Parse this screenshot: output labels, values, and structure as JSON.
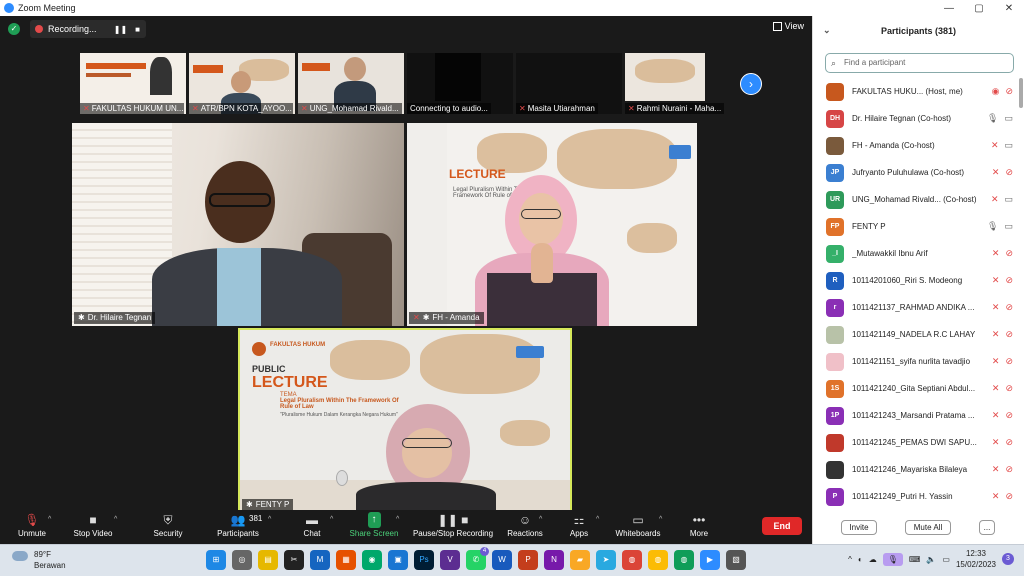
{
  "window": {
    "title": "Zoom Meeting",
    "controls": [
      "—",
      "▢",
      "✕"
    ]
  },
  "topbar": {
    "recording_label": "Recording...",
    "view_label": "View"
  },
  "thumbnails": [
    {
      "name": "FAKULTAS HUKUM UN...",
      "muted": true
    },
    {
      "name": "ATR/BPN KOTA_AYOO...",
      "muted": true
    },
    {
      "name": "UNG_Mohamad Rivald...",
      "muted": true
    },
    {
      "name": "Connecting to audio...",
      "muted": false
    },
    {
      "name": "Masita Utiarahman",
      "muted": true
    },
    {
      "name": "Rahmi Nuraini - Maha...",
      "muted": true
    }
  ],
  "tiles": {
    "a": {
      "name": "Dr. Hilaire Tegnan"
    },
    "b": {
      "name": "FH - Amanda"
    },
    "c": {
      "name": "FENTY P"
    }
  },
  "slide": {
    "kicker": "FAKULTAS HUKUM",
    "public": "PUBLIC",
    "lecture": "LECTURE",
    "tema": "TEMA",
    "theme": "Legal Pluralism Within The Framework Of Rule of Law",
    "subtheme": "\"Pluralisme Hukum Dalam Kerangka Negara Hukum\""
  },
  "toolbar": {
    "unmute": "Unmute",
    "stop_video": "Stop Video",
    "security": "Security",
    "participants": "Participants",
    "participants_count": "381",
    "chat": "Chat",
    "share_screen": "Share Screen",
    "pause_recording": "Pause/Stop Recording",
    "reactions": "Reactions",
    "apps": "Apps",
    "whiteboards": "Whiteboards",
    "more": "More",
    "end": "End"
  },
  "panel": {
    "title": "Participants (381)",
    "search_placeholder": "Find a participant",
    "invite": "Invite",
    "mute_all": "Mute All",
    "more": "...",
    "participants": [
      {
        "initials": "",
        "color": "#c7581e",
        "name": "FAKULTAS HUKU... (Host, me)",
        "mic": "rec",
        "video": "off"
      },
      {
        "initials": "DH",
        "color": "#d64545",
        "name": "Dr. Hilaire Tegnan (Co-host)",
        "mic": "on",
        "video": "on"
      },
      {
        "initials": "",
        "color": "#7a5a3c",
        "name": "FH - Amanda (Co-host)",
        "mic": "off",
        "video": "on"
      },
      {
        "initials": "JP",
        "color": "#3b7fd1",
        "name": "Jufryanto Puluhulawa (Co-host)",
        "mic": "off",
        "video": "off"
      },
      {
        "initials": "UR",
        "color": "#2e9a5a",
        "name": "UNG_Mohamad Rivald... (Co-host)",
        "mic": "off",
        "video": "on"
      },
      {
        "initials": "FP",
        "color": "#e0722a",
        "name": "FENTY P",
        "mic": "on",
        "video": "on"
      },
      {
        "initials": "_I",
        "color": "#35b06a",
        "name": "_Mutawakkil Ibnu Arif",
        "mic": "off",
        "video": "off"
      },
      {
        "initials": "R",
        "color": "#1f5fbf",
        "name": "10114201060_Riri S. Modeong",
        "mic": "off",
        "video": "off"
      },
      {
        "initials": "r",
        "color": "#8a2fb5",
        "name": "1011421137_RAHMAD ANDIKA ...",
        "mic": "off",
        "video": "off"
      },
      {
        "initials": "",
        "color": "#b8c2a8",
        "name": "1011421149_NADELA R.C LAHAY",
        "mic": "off",
        "video": "off"
      },
      {
        "initials": "",
        "color": "#f0c0c8",
        "name": "1011421151_syifa nurlita tavadjio",
        "mic": "off",
        "video": "off"
      },
      {
        "initials": "1S",
        "color": "#e0722a",
        "name": "1011421240_Gita Septiani Abdul...",
        "mic": "off",
        "video": "off"
      },
      {
        "initials": "1P",
        "color": "#8a2fb5",
        "name": "1011421243_Marsandi Pratama ...",
        "mic": "off",
        "video": "off"
      },
      {
        "initials": "",
        "color": "#c0392b",
        "name": "1011421245_PEMAS DWI SAPU...",
        "mic": "off",
        "video": "off"
      },
      {
        "initials": "",
        "color": "#333333",
        "name": "1011421246_Mayariska Bilaleya",
        "mic": "off",
        "video": "off"
      },
      {
        "initials": "P",
        "color": "#8a2fb5",
        "name": "1011421249_Putri H. Yassin",
        "mic": "off",
        "video": "off"
      }
    ]
  },
  "taskbar": {
    "temp": "89°F",
    "weather": "Berawan",
    "time": "12:33",
    "date": "15/02/2023",
    "notifications": "3",
    "whatsapp_badge": "4"
  }
}
